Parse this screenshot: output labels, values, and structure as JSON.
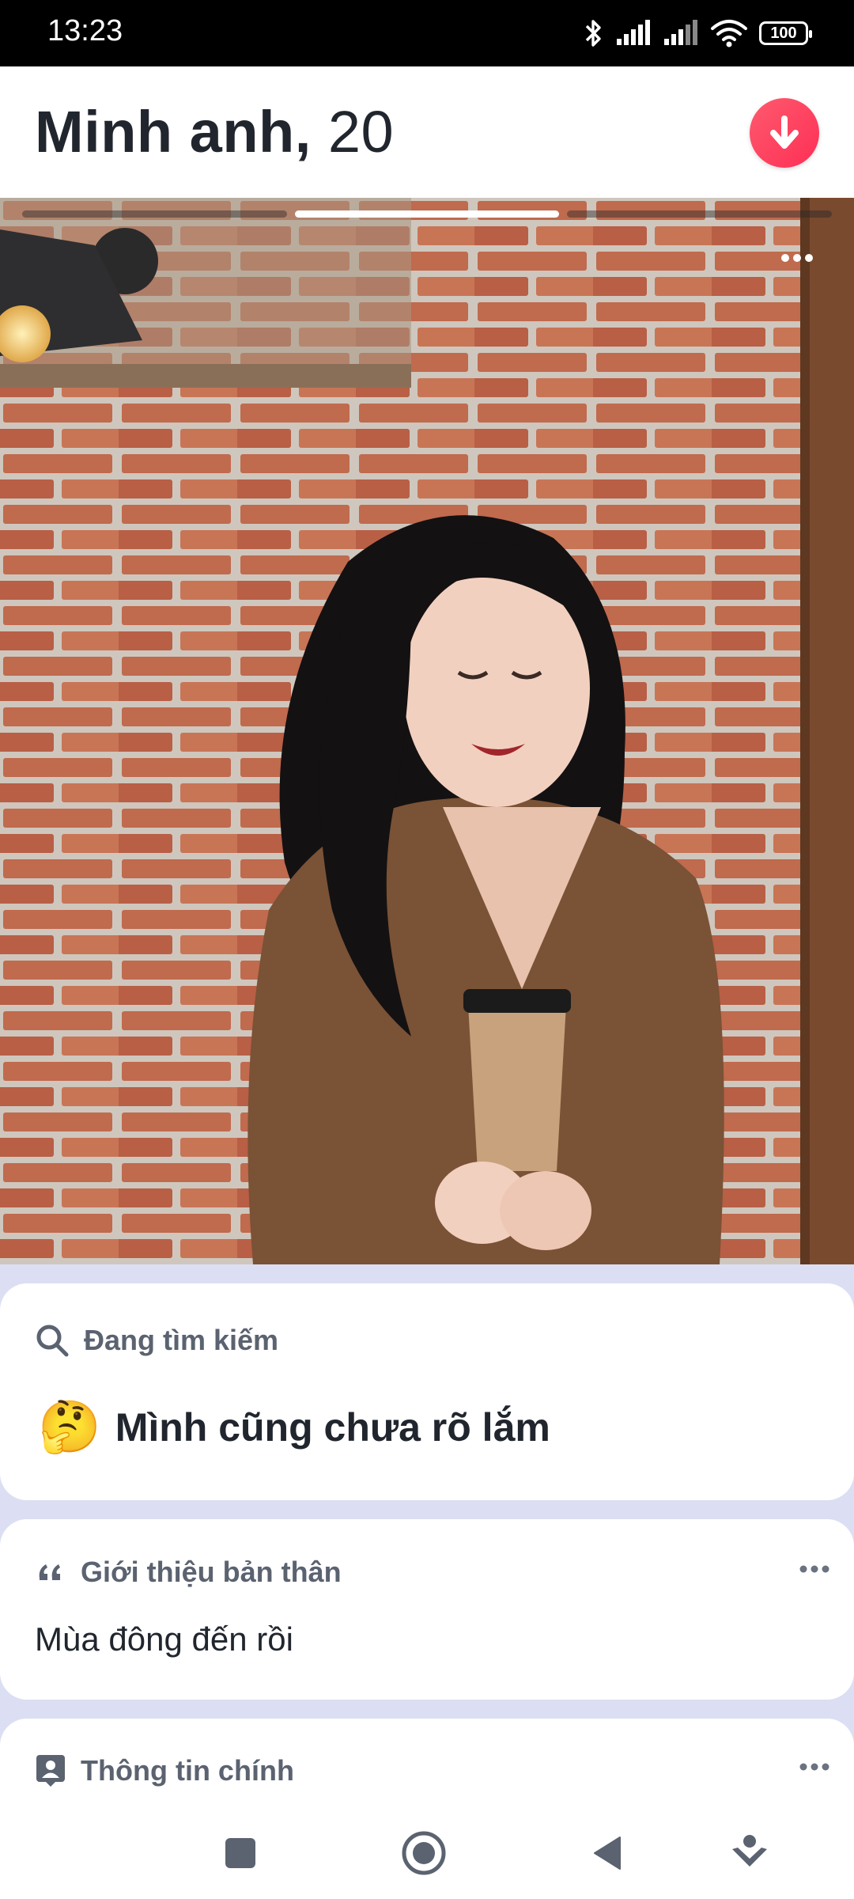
{
  "status_bar": {
    "time": "13:23",
    "battery": "100",
    "icons": [
      "bluetooth-icon",
      "signal-icon",
      "signal-icon",
      "wifi-icon",
      "battery-icon"
    ]
  },
  "profile": {
    "name": "Minh anh,",
    "age": "20"
  },
  "photos": {
    "count": 3,
    "active_index": 1
  },
  "looking_for": {
    "heading": "Đang tìm kiếm",
    "emoji": "🤔",
    "value": "Mình cũng chưa rõ lắm"
  },
  "bio": {
    "heading": "Giới thiệu bản thân",
    "text": "Mùa đông đến rồi"
  },
  "basics": {
    "heading": "Thông tin chính"
  },
  "nav": {
    "icons": [
      "recents-icon",
      "home-icon",
      "back-icon",
      "assistant-icon"
    ]
  },
  "colors": {
    "accent": "#fd2f55",
    "page_background": "#dcdff3",
    "heading_text": "#21262e",
    "label_text": "#5b6270"
  }
}
